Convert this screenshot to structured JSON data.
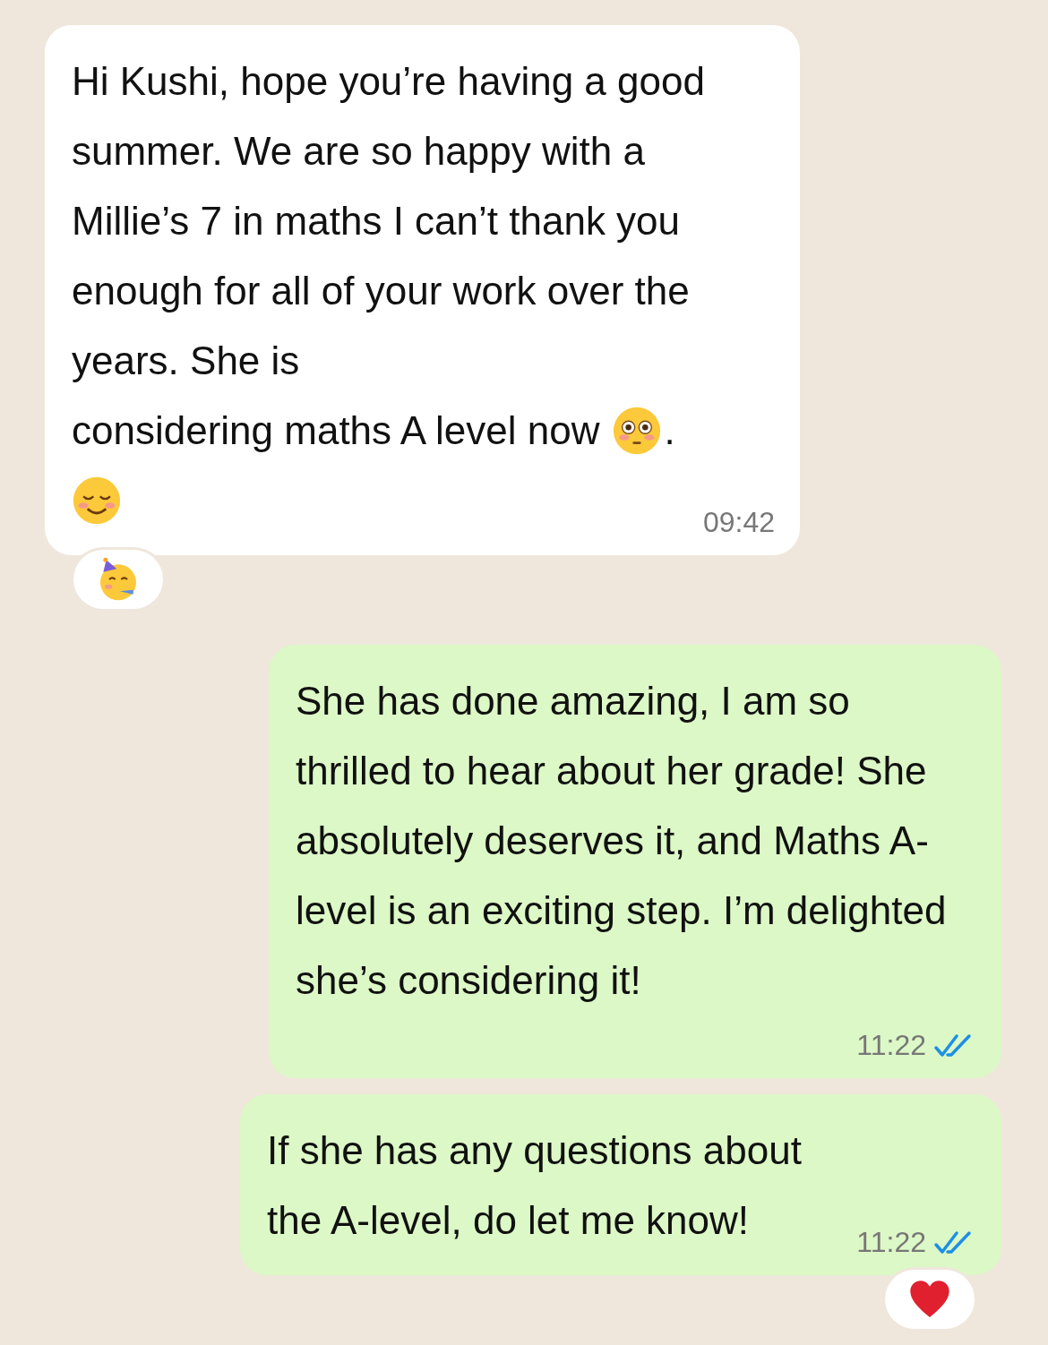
{
  "messages": [
    {
      "kind": "incoming",
      "parts": [
        {
          "kind": "text",
          "text": "Hi Kushi, hope you’re having a good summer. We are so happy with a Millie’s 7 in maths I can’t thank you enough for all of your work over the years. She is"
        },
        {
          "kind": "line",
          "parts": [
            {
              "kind": "text",
              "text": "considering maths A level now"
            },
            {
              "kind": "flushed_emoji"
            },
            {
              "kind": "text",
              "text": "."
            }
          ]
        },
        {
          "kind": "smile_emoji"
        }
      ],
      "time": "09:42",
      "reaction": {
        "kind": "party"
      }
    },
    {
      "kind": "outgoing",
      "parts": [
        {
          "kind": "text",
          "text": "She has done amazing, I am so thrilled to hear about her grade! She absolutely deserves it, and Maths A-level is an exciting step. I’m delighted she’s considering it!"
        }
      ],
      "time": "11:22",
      "read": true
    },
    {
      "kind": "outgoing",
      "parts": [
        {
          "kind": "text",
          "text": "If she has any questions about the A-level, do let me know!"
        }
      ],
      "time": "11:22",
      "read": true,
      "reaction": {
        "kind": "heart"
      }
    }
  ]
}
